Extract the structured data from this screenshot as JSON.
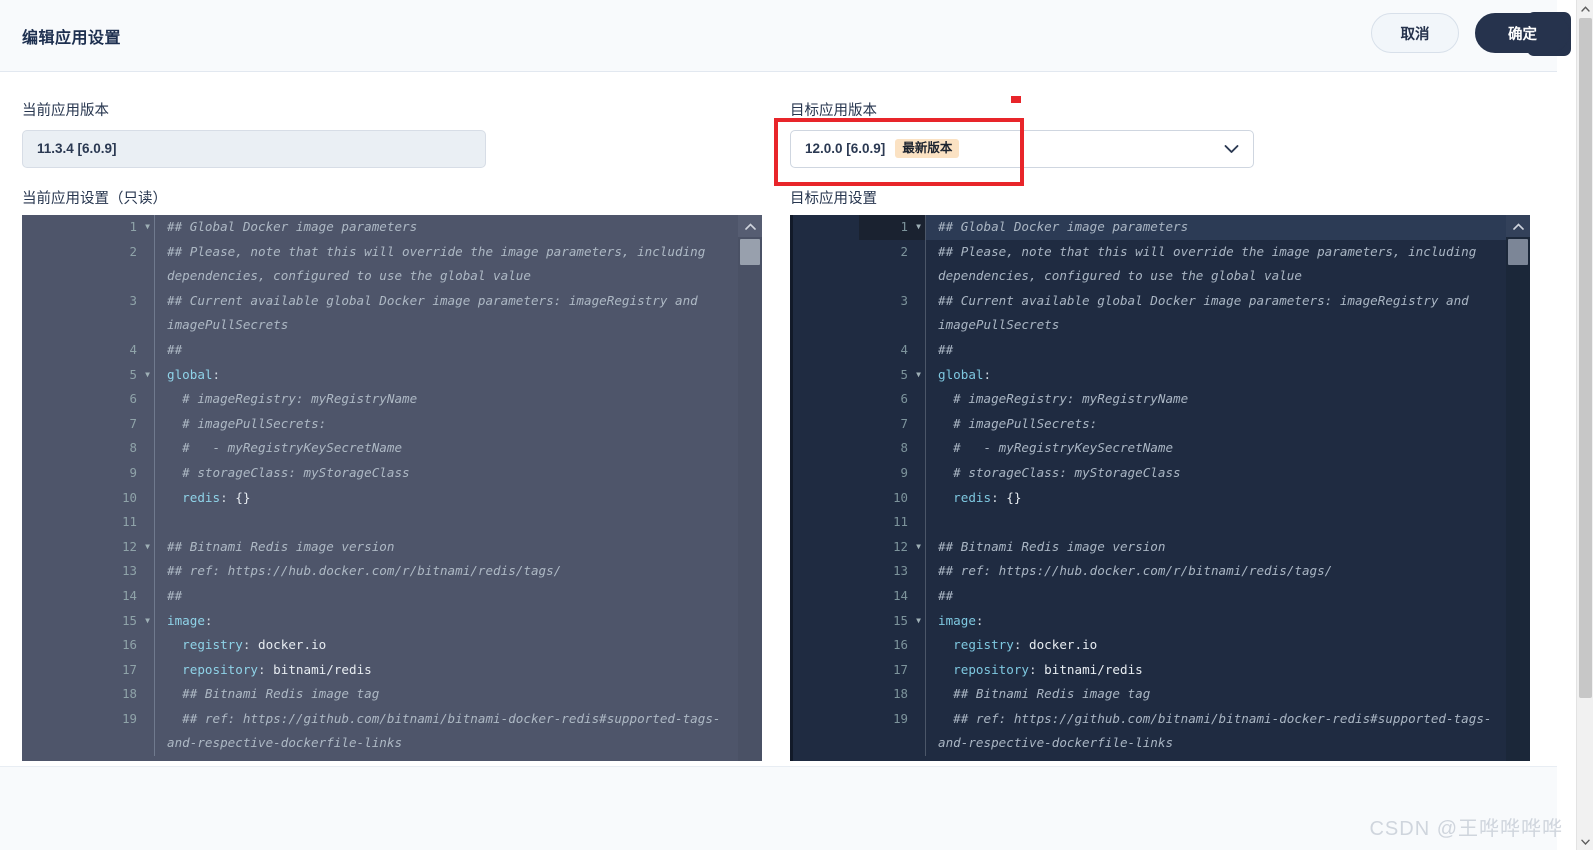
{
  "header": {
    "title": "编辑应用设置",
    "close_icon": "close-icon"
  },
  "current_version": {
    "label": "当前应用版本",
    "value": "11.3.4 [6.0.9]"
  },
  "target_version": {
    "label": "目标应用版本",
    "value": "12.0.0 [6.0.9]",
    "badge": "最新版本",
    "chevron_icon": "chevron-down-icon"
  },
  "current_settings": {
    "label": "当前应用设置（只读）"
  },
  "target_settings": {
    "label": "目标应用设置"
  },
  "footer": {
    "cancel": "取消",
    "confirm": "确定"
  },
  "watermark": "CSDN @王哗哗哗哗",
  "colors": {
    "accent_dark": "#26334d",
    "annotation_red": "#e8252a",
    "badge_bg": "#fbe2c3",
    "editor_left_bg": "#4e556a",
    "editor_right_bg": "#1f2b41"
  },
  "code": {
    "lines": [
      {
        "n": "1",
        "fold": true,
        "segments": [
          {
            "t": "cm",
            "s": "## Global Docker image parameters"
          }
        ]
      },
      {
        "n": "2",
        "fold": false,
        "segments": [
          {
            "t": "cm",
            "s": "## Please, note that this will override the image parameters, including dependencies, configured to use the global value"
          }
        ]
      },
      {
        "n": "3",
        "fold": false,
        "segments": [
          {
            "t": "cm",
            "s": "## Current available global Docker image parameters: imageRegistry and imagePullSecrets"
          }
        ]
      },
      {
        "n": "4",
        "fold": false,
        "segments": [
          {
            "t": "cm",
            "s": "##"
          }
        ]
      },
      {
        "n": "5",
        "fold": true,
        "segments": [
          {
            "t": "key",
            "s": "global"
          },
          {
            "t": "pun",
            "s": ":"
          }
        ]
      },
      {
        "n": "6",
        "fold": false,
        "segments": [
          {
            "t": "cm",
            "s": "  # imageRegistry: myRegistryName"
          }
        ]
      },
      {
        "n": "7",
        "fold": false,
        "segments": [
          {
            "t": "cm",
            "s": "  # imagePullSecrets:"
          }
        ]
      },
      {
        "n": "8",
        "fold": false,
        "segments": [
          {
            "t": "cm",
            "s": "  #   - myRegistryKeySecretName"
          }
        ]
      },
      {
        "n": "9",
        "fold": false,
        "segments": [
          {
            "t": "cm",
            "s": "  # storageClass: myStorageClass"
          }
        ]
      },
      {
        "n": "10",
        "fold": false,
        "segments": [
          {
            "t": "pun",
            "s": "  "
          },
          {
            "t": "key",
            "s": "redis"
          },
          {
            "t": "pun",
            "s": ": "
          },
          {
            "t": "val",
            "s": "{}"
          }
        ]
      },
      {
        "n": "11",
        "fold": false,
        "segments": [
          {
            "t": "pun",
            "s": ""
          }
        ]
      },
      {
        "n": "12",
        "fold": true,
        "segments": [
          {
            "t": "cm",
            "s": "## Bitnami Redis image version"
          }
        ]
      },
      {
        "n": "13",
        "fold": false,
        "segments": [
          {
            "t": "cm",
            "s": "## ref: https://hub.docker.com/r/bitnami/redis/tags/"
          }
        ]
      },
      {
        "n": "14",
        "fold": false,
        "segments": [
          {
            "t": "cm",
            "s": "##"
          }
        ]
      },
      {
        "n": "15",
        "fold": true,
        "segments": [
          {
            "t": "key",
            "s": "image"
          },
          {
            "t": "pun",
            "s": ":"
          }
        ]
      },
      {
        "n": "16",
        "fold": false,
        "segments": [
          {
            "t": "pun",
            "s": "  "
          },
          {
            "t": "key",
            "s": "registry"
          },
          {
            "t": "pun",
            "s": ": "
          },
          {
            "t": "val",
            "s": "docker.io"
          }
        ]
      },
      {
        "n": "17",
        "fold": false,
        "segments": [
          {
            "t": "pun",
            "s": "  "
          },
          {
            "t": "key",
            "s": "repository"
          },
          {
            "t": "pun",
            "s": ": "
          },
          {
            "t": "val",
            "s": "bitnami/redis"
          }
        ]
      },
      {
        "n": "18",
        "fold": false,
        "segments": [
          {
            "t": "cm",
            "s": "  ## Bitnami Redis image tag"
          }
        ]
      },
      {
        "n": "19",
        "fold": false,
        "segments": [
          {
            "t": "cm",
            "s": "  ## ref: https://github.com/bitnami/bitnami-docker-redis#supported-tags-and-respective-dockerfile-links"
          }
        ]
      }
    ]
  }
}
